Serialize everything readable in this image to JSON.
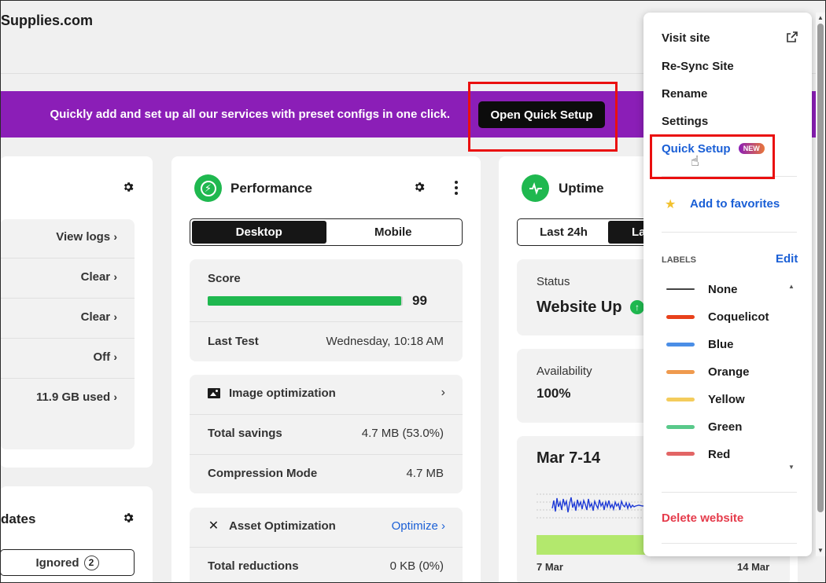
{
  "site_title": "Supplies.com",
  "banner": {
    "text": "Quickly add and set up all our services with preset configs in one click.",
    "button_label": "Open Quick Setup",
    "color": "#8b1eb7"
  },
  "left_card": {
    "rows": [
      {
        "label": "View logs"
      },
      {
        "label": "Clear"
      },
      {
        "label": "Clear"
      },
      {
        "label": "Off"
      },
      {
        "label": "11.9 GB used"
      }
    ],
    "updates_title": "dates",
    "ignored_label": "Ignored",
    "ignored_count": "2"
  },
  "performance": {
    "title": "Performance",
    "tabs": [
      "Desktop",
      "Mobile"
    ],
    "active_tab": "Desktop",
    "score_label": "Score",
    "score_value": "99",
    "score": 99,
    "last_test_label": "Last Test",
    "last_test_value": "Wednesday, 10:18 AM",
    "image_opt": {
      "title": "Image optimization",
      "rows": [
        {
          "label": "Total savings",
          "value": "4.7 MB (53.0%)"
        },
        {
          "label": "Compression Mode",
          "value": "4.7 MB"
        }
      ]
    },
    "asset_opt": {
      "title": "Asset Optimization",
      "action": "Optimize",
      "rows": [
        {
          "label": "Total reductions",
          "value": "0 KB (0%)"
        }
      ]
    }
  },
  "uptime": {
    "title": "Uptime",
    "tabs": [
      "Last 24h",
      "La"
    ],
    "status_label": "Status",
    "status_value": "Website Up",
    "availability_label": "Availability",
    "availability_value": "100%",
    "chart_title": "Mar 7-14",
    "x_start": "7 Mar",
    "x_end": "14 Mar"
  },
  "menu": {
    "items": [
      "Visit site",
      "Re-Sync Site",
      "Rename",
      "Settings"
    ],
    "quick_setup": "Quick Setup",
    "new_badge": "NEW",
    "favorites": "Add to favorites",
    "labels_heading": "LABELS",
    "edit": "Edit",
    "labels": [
      {
        "name": "None",
        "color": "#444444"
      },
      {
        "name": "Coquelicot",
        "color": "#e8411b"
      },
      {
        "name": "Blue",
        "color": "#4a8ee6"
      },
      {
        "name": "Orange",
        "color": "#ef9a4e"
      },
      {
        "name": "Yellow",
        "color": "#f4cc5c"
      },
      {
        "name": "Green",
        "color": "#59c98a"
      },
      {
        "name": "Red",
        "color": "#e26565"
      }
    ],
    "delete": "Delete website"
  },
  "colors": {
    "accent_blue": "#1a5fd6",
    "success_green": "#1fb84f",
    "danger_red": "#e53b4b"
  }
}
